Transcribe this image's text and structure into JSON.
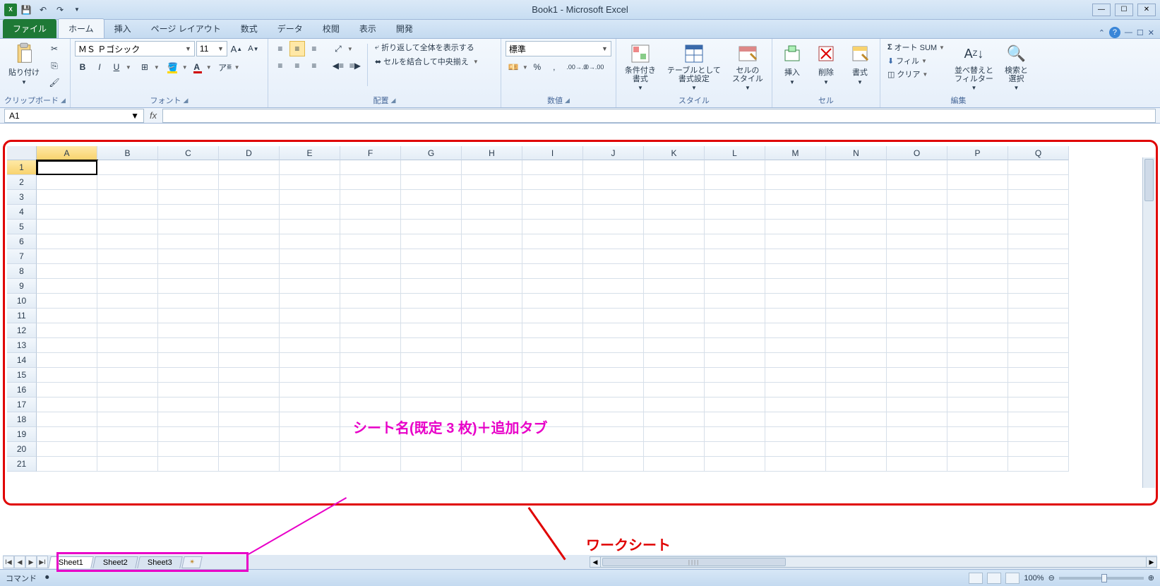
{
  "titlebar": {
    "title": "Book1 - Microsoft Excel"
  },
  "tabs": {
    "file": "ファイル",
    "items": [
      "ホーム",
      "挿入",
      "ページ レイアウト",
      "数式",
      "データ",
      "校閲",
      "表示",
      "開発"
    ]
  },
  "clipboard": {
    "paste": "貼り付け",
    "label": "クリップボード"
  },
  "font": {
    "name": "ＭＳ Ｐゴシック",
    "size": "11",
    "label": "フォント",
    "bold": "B",
    "italic": "I",
    "underline": "U"
  },
  "alignment": {
    "wrap": "折り返して全体を表示する",
    "merge": "セルを結合して中央揃え",
    "label": "配置"
  },
  "number": {
    "format": "標準",
    "label": "数値"
  },
  "styles": {
    "cond": "条件付き\n書式",
    "table": "テーブルとして\n書式設定",
    "cell": "セルの\nスタイル",
    "label": "スタイル"
  },
  "cells": {
    "insert": "挿入",
    "delete": "削除",
    "format": "書式",
    "label": "セル"
  },
  "editing": {
    "autosum": "オート SUM",
    "fill": "フィル",
    "clear": "クリア",
    "sort": "並べ替えと\nフィルター",
    "find": "検索と\n選択",
    "label": "編集"
  },
  "namebox": "A1",
  "columns": [
    "A",
    "B",
    "C",
    "D",
    "E",
    "F",
    "G",
    "H",
    "I",
    "J",
    "K",
    "L",
    "M",
    "N",
    "O",
    "P",
    "Q"
  ],
  "rows": [
    "1",
    "2",
    "3",
    "4",
    "5",
    "6",
    "7",
    "8",
    "9",
    "10",
    "11",
    "12",
    "13",
    "14",
    "15",
    "16",
    "17",
    "18",
    "19",
    "20",
    "21"
  ],
  "sheets": [
    "Sheet1",
    "Sheet2",
    "Sheet3"
  ],
  "status": {
    "cmd": "コマンド",
    "zoom": "100%"
  },
  "annotations": {
    "sheet_tabs": "シート名(既定 3 枚)＋追加タブ",
    "worksheet": "ワークシート"
  }
}
